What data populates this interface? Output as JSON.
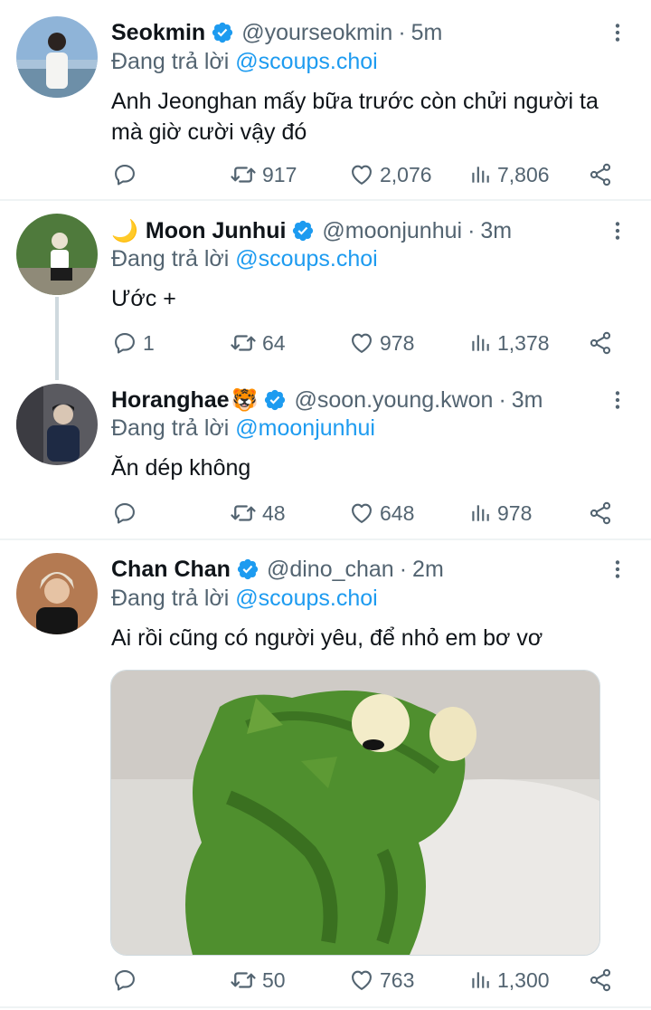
{
  "tweets": [
    {
      "name": "Seokmin",
      "name_prefix": "",
      "name_suffix": "",
      "handle": "@yourseokmin",
      "time": "5m",
      "reply_prefix": "Đang trả lời",
      "reply_to": "@scoups.choi",
      "text_line1": "Anh Jeonghan mấy bữa trước còn chửi người ta",
      "text_line2": "mà giờ cười vậy đó",
      "replies": "",
      "retweets": "917",
      "likes": "2,076",
      "views": "7,806"
    },
    {
      "name": "Moon Junhui",
      "name_prefix": "🌙",
      "name_suffix": "",
      "handle": "@moonjunhui",
      "time": "3m",
      "reply_prefix": "Đang trả lời",
      "reply_to": "@scoups.choi",
      "text_line1": "Ước +",
      "replies": "1",
      "retweets": "64",
      "likes": "978",
      "views": "1,378"
    },
    {
      "name": "Horanghae",
      "name_prefix": "",
      "name_suffix": "🐯",
      "handle": "@soon.young.kwon",
      "time": "3m",
      "reply_prefix": "Đang trả lời",
      "reply_to": "@moonjunhui",
      "text_line1": "Ăn dép không",
      "replies": "",
      "retweets": "48",
      "likes": "648",
      "views": "978"
    },
    {
      "name": "Chan Chan",
      "name_prefix": "",
      "name_suffix": "",
      "handle": "@dino_chan",
      "time": "2m",
      "reply_prefix": "Đang trả lời",
      "reply_to": "@scoups.choi",
      "text_line1": "Ai rồi cũng có người yêu, để nhỏ em bơ vơ",
      "replies": "",
      "retweets": "50",
      "likes": "763",
      "views": "1,300"
    }
  ],
  "colors": {
    "accent": "#1d9bf0",
    "secondary_text": "#536471",
    "divider": "#eff3f4"
  },
  "icons": [
    "verified-badge-icon",
    "more-options-icon",
    "reply-icon",
    "retweet-icon",
    "like-icon",
    "views-icon",
    "share-icon"
  ]
}
